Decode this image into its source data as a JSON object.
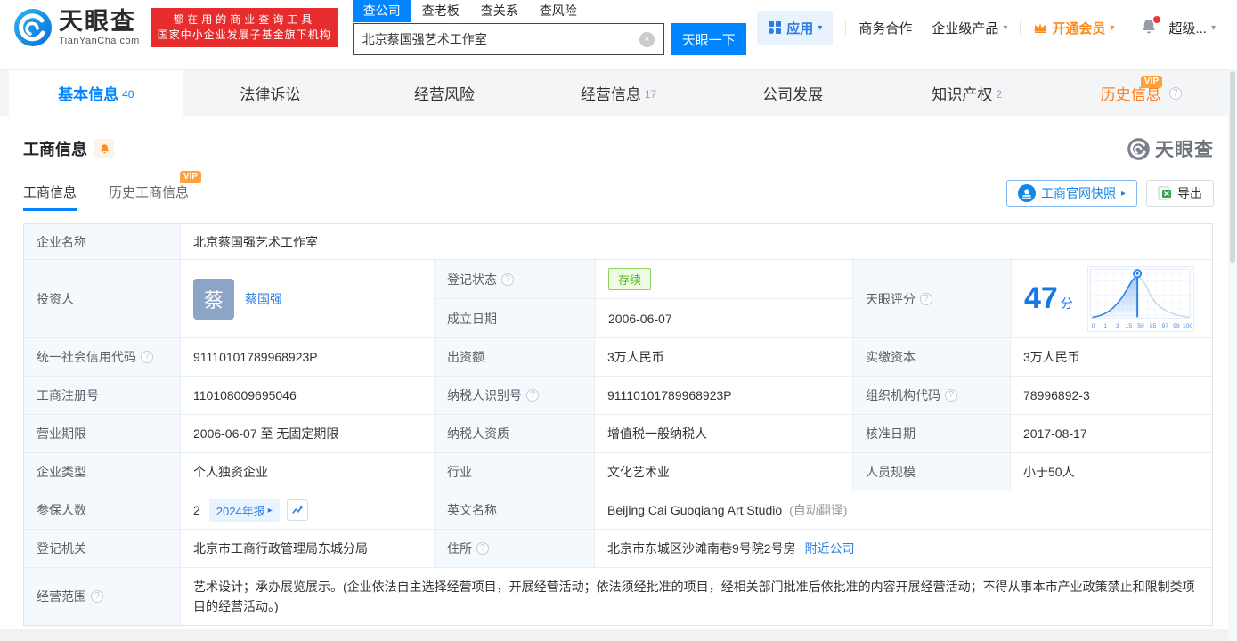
{
  "colors": {
    "primary": "#0084ff",
    "orange": "#ff8a1e",
    "red": "#e62c2c",
    "green": "#52b51e",
    "link": "#2a7de1",
    "score_blue": "#1677e8",
    "label_bg": "#f3f9fd"
  },
  "icons": {
    "caret_down": "▾",
    "clear": "×",
    "arrow_right": "▸",
    "help": "?"
  },
  "header": {
    "logo": {
      "name": "天眼查",
      "domain": "TianYanCha.com"
    },
    "slogan": {
      "line1": "都在用的商业查询工具",
      "line2": "国家中小企业发展子基金旗下机构"
    },
    "search": {
      "tabs": [
        {
          "label": "查公司"
        },
        {
          "label": "查老板"
        },
        {
          "label": "查关系"
        },
        {
          "label": "查风险"
        }
      ],
      "value": "北京蔡国强艺术工作室",
      "button": "天眼一下"
    },
    "nav": {
      "apps": "应用",
      "cooperation": "商务合作",
      "enterprise": "企业级产品",
      "vip": "开通会员",
      "user": "超级..."
    }
  },
  "tabs": [
    {
      "label": "基本信息",
      "count": "40"
    },
    {
      "label": "法律诉讼",
      "count": ""
    },
    {
      "label": "经营风险",
      "count": ""
    },
    {
      "label": "经营信息",
      "count": "17"
    },
    {
      "label": "公司发展",
      "count": ""
    },
    {
      "label": "知识产权",
      "count": "2"
    },
    {
      "label": "历史信息",
      "count": ""
    }
  ],
  "vip_label": "VIP",
  "section": {
    "title": "工商信息",
    "watermark": "天眼查",
    "subtabs": [
      {
        "label": "工商信息"
      },
      {
        "label": "历史工商信息"
      }
    ],
    "snapshot_button": "工商官网快照",
    "export_button": "导出"
  },
  "grid": {
    "company_name": {
      "label": "企业名称",
      "value": "北京蔡国强艺术工作室"
    },
    "investor": {
      "label": "投资人",
      "avatar": "蔡",
      "name": "蔡国强"
    },
    "status": {
      "label": "登记状态",
      "value": "存续"
    },
    "established": {
      "label": "成立日期",
      "value": "2006-06-07"
    },
    "score": {
      "label": "天眼评分",
      "value": "47",
      "unit": "分",
      "axis": [
        "0",
        "1",
        "3",
        "15",
        "50",
        "85",
        "97",
        "99",
        "100"
      ]
    },
    "rows": [
      {
        "l1": "统一社会信用代码",
        "v1": "91110101789968923P",
        "l2": "出资额",
        "v2": "3万人民币",
        "l3": "实缴资本",
        "v3": "3万人民币"
      },
      {
        "l1": "工商注册号",
        "v1": "110108009695046",
        "l2": "纳税人识别号",
        "v2": "91110101789968923P",
        "l3": "组织机构代码",
        "v3": "78996892-3"
      },
      {
        "l1": "营业期限",
        "v1": "2006-06-07 至 无固定期限",
        "l2": "纳税人资质",
        "v2": "增值税一般纳税人",
        "l3": "核准日期",
        "v3": "2017-08-17"
      },
      {
        "l1": "企业类型",
        "v1": "个人独资企业",
        "l2": "行业",
        "v2": "文化艺术业",
        "l3": "人员规模",
        "v3": "小于50人"
      }
    ],
    "insured": {
      "label": "参保人数",
      "value": "2",
      "report_badge": "2024年报"
    },
    "english_name": {
      "label": "英文名称",
      "value": "Beijing Cai Guoqiang Art Studio",
      "note": "(自动翻译)"
    },
    "registry": {
      "label": "登记机关",
      "value": "北京市工商行政管理局东城分局"
    },
    "address": {
      "label": "住所",
      "value": "北京市东城区沙滩南巷9号院2号房",
      "nearby_link": "附近公司"
    },
    "business_scope": {
      "label": "经营范围",
      "value": "艺术设计；承办展览展示。(企业依法自主选择经营项目，开展经营活动；依法须经批准的项目，经相关部门批准后依批准的内容开展经营活动；不得从事本市产业政策禁止和限制类项目的经营活动。)"
    }
  },
  "chart_data": {
    "type": "area",
    "title": "天眼评分分布曲线",
    "x": [
      0,
      1,
      3,
      15,
      50,
      85,
      97,
      99,
      100
    ],
    "marker_value": 47,
    "series": [
      {
        "name": "score-distribution",
        "shape": "bell-curve",
        "peak_at": 47
      }
    ],
    "legend_position": "none",
    "grid": true
  }
}
